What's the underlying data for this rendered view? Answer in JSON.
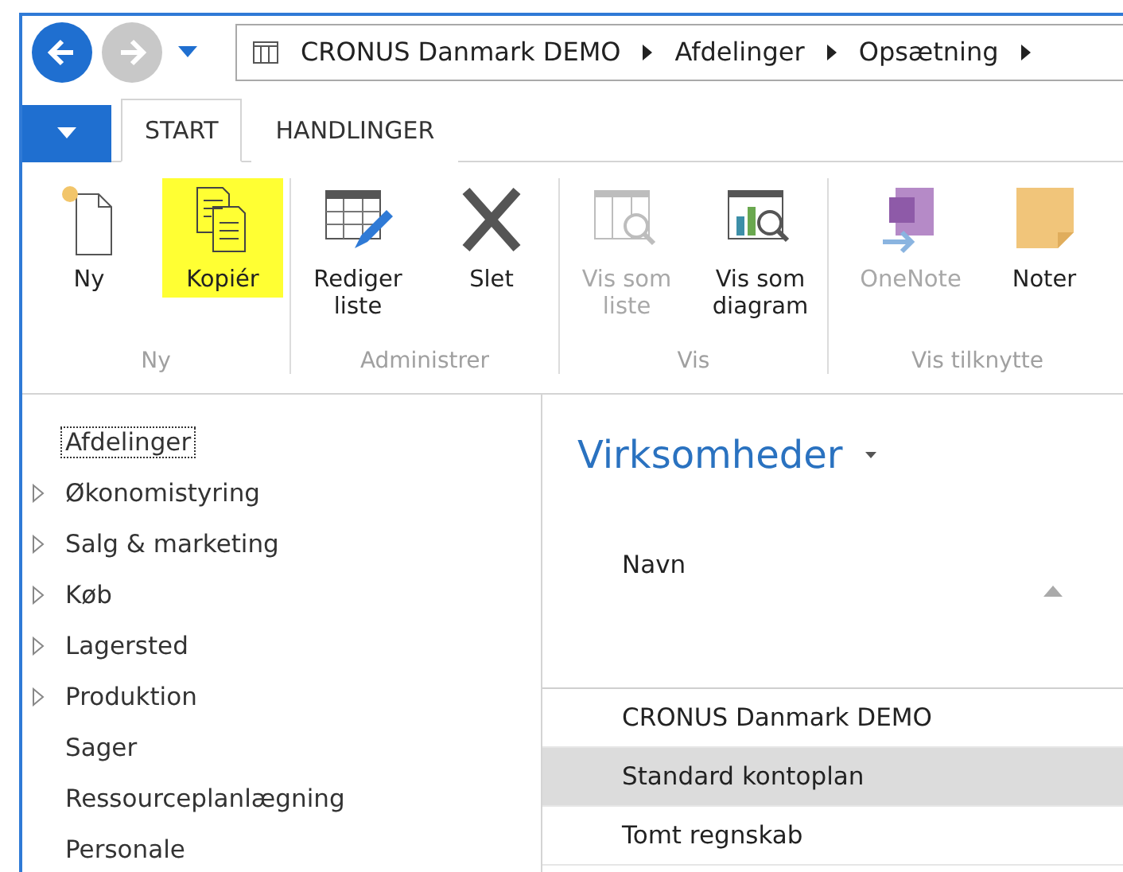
{
  "breadcrumb": [
    "CRONUS Danmark DEMO",
    "Afdelinger",
    "Opsætning"
  ],
  "ribbon_tabs": [
    {
      "label": "START",
      "selected": true
    },
    {
      "label": "HANDLINGER",
      "selected": false
    }
  ],
  "ribbon_groups": [
    {
      "label": "Ny",
      "buttons": [
        {
          "label": "Ny",
          "kind": "new",
          "disabled": false,
          "highlighted": false
        },
        {
          "label": "Kopiér",
          "kind": "copy",
          "disabled": false,
          "highlighted": true
        }
      ]
    },
    {
      "label": "Administrer",
      "buttons": [
        {
          "label": "Rediger liste",
          "kind": "edit",
          "disabled": false,
          "highlighted": false
        },
        {
          "label": "Slet",
          "kind": "delete",
          "disabled": false,
          "highlighted": false
        }
      ]
    },
    {
      "label": "Vis",
      "buttons": [
        {
          "label": "Vis som liste",
          "kind": "list",
          "disabled": true,
          "highlighted": false
        },
        {
          "label": "Vis som diagram",
          "kind": "chart",
          "disabled": false,
          "highlighted": false
        }
      ]
    },
    {
      "label": "Vis tilknytte",
      "buttons": [
        {
          "label": "OneNote",
          "kind": "onenote",
          "disabled": true,
          "highlighted": false
        },
        {
          "label": "Noter",
          "kind": "note",
          "disabled": false,
          "highlighted": false
        }
      ]
    }
  ],
  "nav_items": [
    {
      "label": "Afdelinger",
      "expandable": false,
      "selected": true
    },
    {
      "label": "Økonomistyring",
      "expandable": true,
      "selected": false
    },
    {
      "label": "Salg & marketing",
      "expandable": true,
      "selected": false
    },
    {
      "label": "Køb",
      "expandable": true,
      "selected": false
    },
    {
      "label": "Lagersted",
      "expandable": true,
      "selected": false
    },
    {
      "label": "Produktion",
      "expandable": true,
      "selected": false
    },
    {
      "label": "Sager",
      "expandable": false,
      "selected": false
    },
    {
      "label": "Ressourceplanlægning",
      "expandable": false,
      "selected": false
    },
    {
      "label": "Personale",
      "expandable": false,
      "selected": false
    }
  ],
  "page_title": "Virksomheder",
  "table": {
    "columns": [
      {
        "label": "Navn",
        "sorted_ascending": true
      }
    ],
    "rows": [
      {
        "name": "CRONUS Danmark DEMO",
        "selected": false
      },
      {
        "name": "Standard kontoplan",
        "selected": true
      },
      {
        "name": "Tomt regnskab",
        "selected": false
      }
    ]
  }
}
